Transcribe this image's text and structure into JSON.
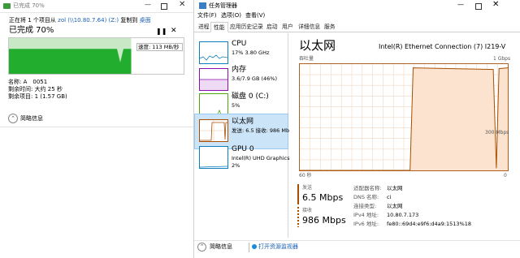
{
  "copy_dialog": {
    "title": "已完成 70%",
    "status_prefix": "正在将 1 个项目从",
    "source": "zol (\\\\10.80.7.64) (Z:)",
    "status_middle": "复制到",
    "destination": "桌面",
    "percent_text": "已完成 70%",
    "progress": 0.7,
    "speed_text": "速度: 113 MB/秒",
    "details": [
      "名称: A　0051",
      "剩余时间: 大约 25 秒",
      "剩余项目: 1 (1.57 GB)"
    ],
    "more_info": "简略信息",
    "colors": {
      "fill": "#22ad2e",
      "band": "#c9e8c6"
    }
  },
  "task_manager": {
    "title": "任务管理器",
    "menu": [
      "文件(F)",
      "选项(O)",
      "查看(V)"
    ],
    "tabs": [
      "进程",
      "性能",
      "应用历史记录",
      "启动",
      "用户",
      "详细信息",
      "服务"
    ],
    "active_tab": "性能",
    "items": [
      {
        "name": "CPU",
        "sub": "17%  3.80 GHz",
        "color": "#117dbb"
      },
      {
        "name": "内存",
        "sub": "3.6/7.9 GB (46%)",
        "color": "#8b12ae"
      },
      {
        "name": "磁盘 0 (C:)",
        "sub": "5%",
        "color": "#4da60c"
      },
      {
        "name": "以太网",
        "sub": "发送: 6.5  接收: 986 Mb",
        "color": "#a74f01"
      },
      {
        "name": "GPU 0",
        "sub": "Intel(R) UHD Graphics",
        "sub2": "2%",
        "color": "#117dbb"
      }
    ],
    "selected": "以太网",
    "panel": {
      "title": "以太网",
      "adapter": "Intel(R) Ethernet Connection (7) I219-V",
      "throughput_label": "吞吐量",
      "max_label": "1 Gbps",
      "mid_label": "300 Mbps",
      "seconds_label": "60 秒",
      "zero_label": "0",
      "send_label": "发送",
      "send_value": "6.5 Mbps",
      "recv_label": "接收",
      "recv_value": "986 Mbps",
      "info": [
        {
          "k": "适配器名称:",
          "v": "以太网"
        },
        {
          "k": "DNS 名称:",
          "v": "ci"
        },
        {
          "k": "连接类型:",
          "v": "以太网"
        },
        {
          "k": "IPv4 地址:",
          "v": "10.80.7.173"
        },
        {
          "k": "IPv6 地址:",
          "v": "fe80::69d4:e9f6:d4a9:1513%18"
        }
      ],
      "colors": {
        "line": "#a74f01",
        "fill": "#fce3cf",
        "grid": "#f0d8c4"
      }
    },
    "bottom": {
      "more_info": "简略信息",
      "monitor_link": "打开资源监视器"
    }
  }
}
